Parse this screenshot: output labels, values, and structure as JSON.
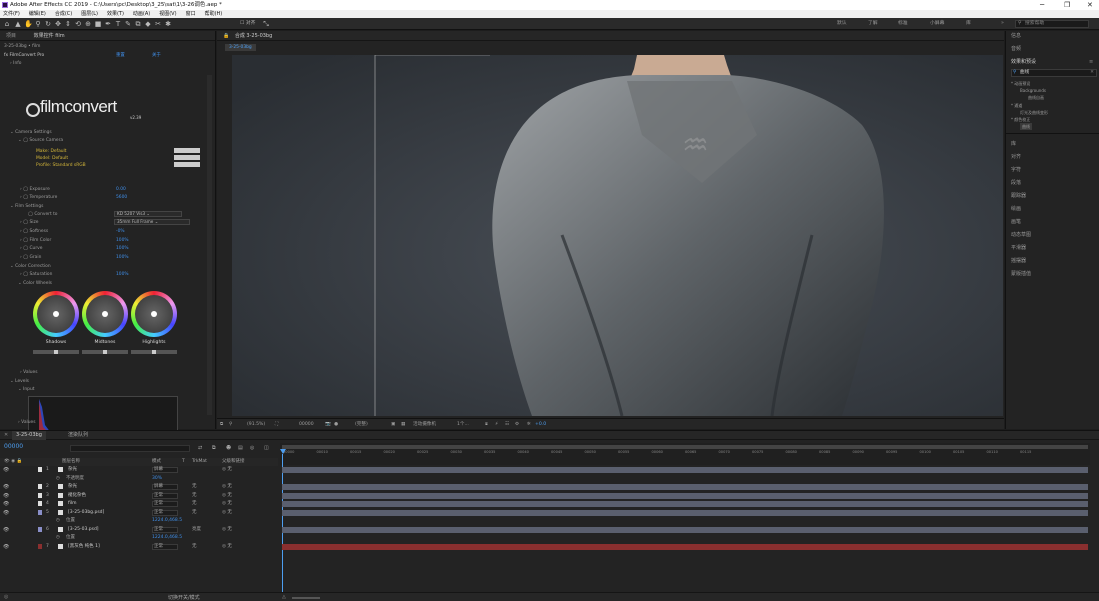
{
  "app": {
    "title": "Adobe After Effects CC 2019 - C:\\Users\\pc\\Desktop\\3_25\\sat\\1\\3-26调色.aep *"
  },
  "menu": [
    "文件(F)",
    "编辑(E)",
    "合成(C)",
    "图层(L)",
    "效果(T)",
    "动画(A)",
    "视图(V)",
    "窗口",
    "帮助(H)"
  ],
  "toolbar": {
    "align_label": "对齐",
    "workspaces": [
      "默认",
      "了解",
      "标准",
      "小屏幕",
      "库"
    ],
    "search_placeholder": "搜索帮助"
  },
  "left_panel": {
    "tab_project": "项目",
    "tab_effects": "效果控件 film",
    "layer_path": "3-25-03bg • film",
    "effect_name": "FilmConvert Pro",
    "reset": "重置",
    "about": "关于",
    "logo_text": "filmconvert",
    "version": "v2.39",
    "rows": [
      {
        "label": "Info"
      },
      {
        "label": "Camera Settings"
      },
      {
        "label": "Source Camera"
      },
      {
        "label": "Make:",
        "value": "Default"
      },
      {
        "label": "Model:",
        "value": "Default"
      },
      {
        "label": "Profile:",
        "value": "Standard sRGB"
      },
      {
        "label": "Exposure",
        "value": "0.00"
      },
      {
        "label": "Temperature",
        "value": "5600"
      },
      {
        "label": "Film Settings"
      },
      {
        "label": "Convert to",
        "value": "KD 5207 Vis3"
      },
      {
        "label": "Size",
        "value": "35mm Full Frame"
      },
      {
        "label": "Softness",
        "value": "-0%"
      },
      {
        "label": "Film Color",
        "value": "100%"
      },
      {
        "label": "Curve",
        "value": "100%"
      },
      {
        "label": "Grain",
        "value": "100%"
      },
      {
        "label": "Color Correction"
      },
      {
        "label": "Saturation",
        "value": "100%"
      },
      {
        "label": "Color Wheels"
      },
      {
        "label": "Values"
      },
      {
        "label": "Levels"
      },
      {
        "label": "Input"
      },
      {
        "label": "Values"
      }
    ],
    "wheels": [
      "Shadows",
      "Midtones",
      "Highlights"
    ]
  },
  "composition": {
    "tab": "合成 3-25-03bg",
    "breadcrumb": "3-25-03bg",
    "zoom": "(91.5%)",
    "timecode": "00000",
    "quality": "(完整)",
    "camera": "活动摄像机",
    "views": "1个...",
    "exposure": "+0.0"
  },
  "right_panel": {
    "items_top": [
      "信息",
      "音频"
    ],
    "effects_title": "效果和预设",
    "search_value": "曲线",
    "tree": [
      "* 动画预设",
      "Backgrounds",
      "曲线自画",
      "* 通道",
      "灯光及曲线变形",
      "* 颜色校正",
      "曲线"
    ],
    "panels": [
      "库",
      "对齐",
      "字符",
      "段落",
      "跟踪器",
      "绘画",
      "画笔",
      "动态草图",
      "平滑器",
      "摇摆器",
      "蒙版插值"
    ]
  },
  "timeline": {
    "tab_comp": "3-25-03bg",
    "tab_render": "渲染队列",
    "timecode": "00000",
    "col_headers": [
      "图层名称",
      "模式",
      "T",
      "TrkMat",
      "父级和链接"
    ],
    "layers": [
      {
        "num": "1",
        "name": "杂光",
        "mode": "屏幕",
        "trk": "",
        "parent": "无",
        "sub": "不透明度",
        "subval": "30%"
      },
      {
        "num": "2",
        "name": "杂光",
        "mode": "屏幕",
        "trk": "无",
        "parent": "无"
      },
      {
        "num": "3",
        "name": "褪化杂色",
        "mode": "正常",
        "trk": "无",
        "parent": "无"
      },
      {
        "num": "4",
        "name": "film",
        "mode": "正常",
        "trk": "无",
        "parent": "无"
      },
      {
        "num": "5",
        "name": "[3-25-03bg.psd]",
        "mode": "正常",
        "trk": "无",
        "parent": "无",
        "sub": "位置",
        "subval": "1224.0,468.5"
      },
      {
        "num": "6",
        "name": "[3-25-03.psd]",
        "mode": "正常",
        "trk": "亮度",
        "parent": "无",
        "sub": "位置",
        "subval": "1224.0,468.5"
      },
      {
        "num": "7",
        "name": "[黑灰色 纯色 1]",
        "mode": "正常",
        "trk": "无",
        "parent": "无"
      }
    ],
    "ruler": [
      "00000",
      "00010",
      "00015",
      "00020",
      "00025",
      "00030",
      "00035",
      "00040",
      "00045",
      "00050",
      "00055",
      "00060",
      "00065",
      "00070",
      "00075",
      "00080",
      "00085",
      "00090",
      "00095",
      "00100",
      "00105",
      "00110",
      "00115"
    ],
    "footer": "切换开关/模式"
  },
  "colors": {
    "accent": "#3f8ee8",
    "red_layer": "#8a2f2f"
  }
}
